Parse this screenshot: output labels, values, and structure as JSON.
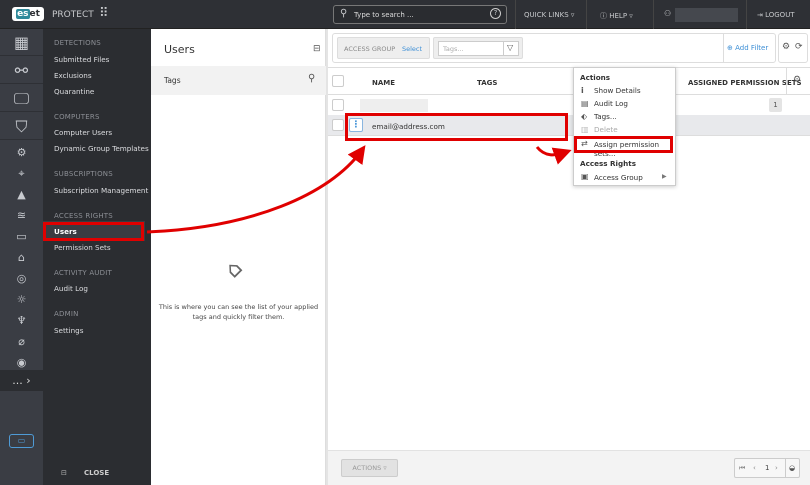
{
  "topbar": {
    "logo": "eset",
    "product": "PROTECT",
    "search_placeholder": "Type to search ...",
    "quick_links": "QUICK LINKS",
    "help": "HELP",
    "logout": "LOGOUT"
  },
  "nav": {
    "sections": [
      {
        "header": "DETECTIONS",
        "items": [
          "Submitted Files",
          "Exclusions",
          "Quarantine"
        ]
      },
      {
        "header": "COMPUTERS",
        "items": [
          "Computer Users",
          "Dynamic Group Templates"
        ]
      },
      {
        "header": "SUBSCRIPTIONS",
        "items": [
          "Subscription Management"
        ]
      },
      {
        "header": "ACCESS RIGHTS",
        "items": [
          "Users",
          "Permission Sets"
        ]
      },
      {
        "header": "ACTIVITY AUDIT",
        "items": [
          "Audit Log"
        ]
      },
      {
        "header": "ADMIN",
        "items": [
          "Settings"
        ]
      }
    ],
    "selected": "Users",
    "close": "CLOSE",
    "more": "..."
  },
  "users_panel": {
    "title": "Users",
    "tags_label": "Tags",
    "empty_text": "This is where you can see the list of your applied tags and quickly filter them."
  },
  "filters": {
    "access_group_label": "ACCESS GROUP",
    "access_group_value": "Select",
    "tags_placeholder": "Tags...",
    "add_filter": "Add Filter"
  },
  "table": {
    "columns": [
      "NAME",
      "TAGS",
      "ASSIGNED PERMISSION SETS"
    ],
    "rows": [
      {
        "name": "",
        "permission_sets": "1"
      },
      {
        "name": "email@address.com",
        "permission_sets": ""
      }
    ]
  },
  "context_menu": {
    "actions_header": "Actions",
    "items": [
      "Show Details",
      "Audit Log",
      "Tags...",
      "Delete",
      "Assign permission sets..."
    ],
    "access_header": "Access Rights",
    "access_items": [
      "Access Group"
    ]
  },
  "footer": {
    "actions": "ACTIONS",
    "page": "1"
  },
  "colors": {
    "highlight": "#e00000",
    "link": "#3d8fd6",
    "sidebar": "#2b2d31",
    "topbar": "#2e3035"
  }
}
